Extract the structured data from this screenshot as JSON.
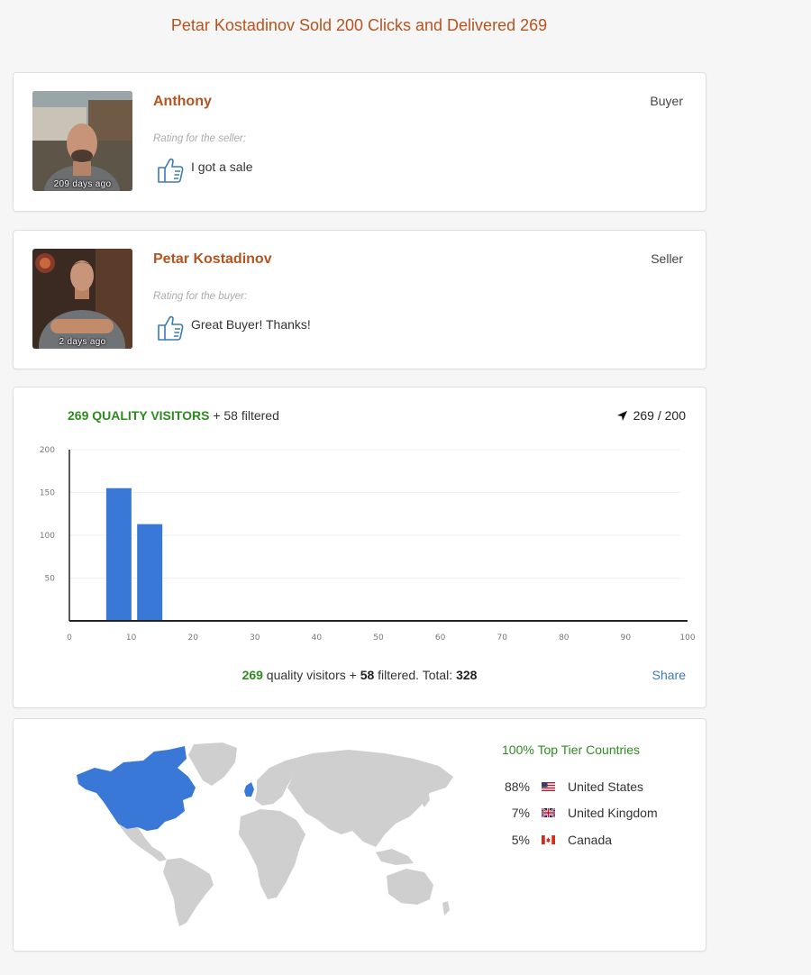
{
  "title": "Petar Kostadinov Sold 200 Clicks and Delivered 269",
  "reviews": [
    {
      "name": "Anthony",
      "role": "Buyer",
      "label": "Rating for the seller:",
      "text": "I got a sale",
      "age": "209 days ago"
    },
    {
      "name": "Petar Kostadinov",
      "role": "Seller",
      "label": "Rating for the buyer:",
      "text": "Great Buyer! Thanks!",
      "age": "2 days ago"
    }
  ],
  "stats": {
    "quality_count": "269 QUALITY VISITORS",
    "filtered_text": "+ 58 filtered",
    "clicks": "269 / 200",
    "summary": {
      "quality": "269",
      "mid": " quality visitors + ",
      "filtered": "58",
      "filtered_suffix": " filtered. Total: ",
      "total": "328"
    },
    "share_label": "Share",
    "accent_color": "#2e8b1f"
  },
  "chart_data": {
    "type": "bar",
    "x": [
      8,
      13
    ],
    "values": [
      155,
      113
    ],
    "xlim": [
      0,
      100
    ],
    "ylim": [
      0,
      200
    ],
    "xticks": [
      0,
      10,
      20,
      30,
      40,
      50,
      60,
      70,
      80,
      90,
      100
    ],
    "yticks": [
      50,
      100,
      150,
      200
    ],
    "bar_color": "#3a78d8",
    "grid": true
  },
  "geo": {
    "tier_label": "100% Top Tier Countries",
    "countries": [
      {
        "pct": "88%",
        "name": "United States",
        "flag": "us-flag-icon"
      },
      {
        "pct": "7%",
        "name": "United Kingdom",
        "flag": "uk-flag-icon"
      },
      {
        "pct": "5%",
        "name": "Canada",
        "flag": "ca-flag-icon"
      }
    ],
    "highlight_color": "#3a78d8",
    "land_color": "#cfcfcf"
  }
}
